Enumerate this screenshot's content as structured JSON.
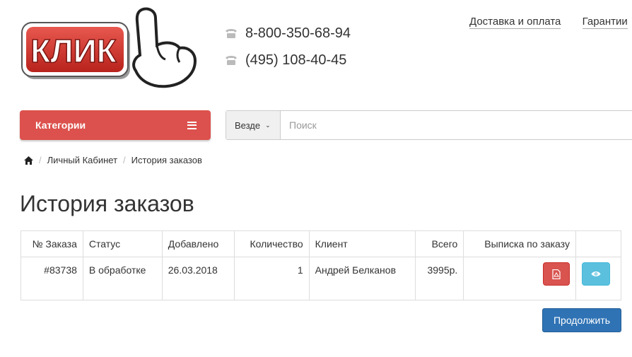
{
  "logo": {
    "text": "КЛИК"
  },
  "header": {
    "phones": [
      "8-800-350-68-94",
      "(495) 108-40-45"
    ],
    "links": [
      "Доставка и оплата",
      "Гарантии"
    ]
  },
  "categories_label": "Категории",
  "search": {
    "scope": "Везде",
    "placeholder": "Поиск"
  },
  "breadcrumb": [
    "Личный Кабинет",
    "История заказов"
  ],
  "page_title": "История заказов",
  "table": {
    "headers": [
      "№ Заказа",
      "Статус",
      "Добавлено",
      "Количество",
      "Клиент",
      "Всего",
      "Выписка по заказу",
      ""
    ],
    "rows": [
      {
        "id": "#83738",
        "status": "В обработке",
        "date": "26.03.2018",
        "qty": "1",
        "client": "Андрей Белканов",
        "total": "3995р."
      }
    ]
  },
  "continue_label": "Продолжить",
  "colors": {
    "brand_red": "#dc514d",
    "primary_blue": "#2f73b5",
    "info_cyan": "#5bc0de"
  },
  "icons": [
    "phone-icon",
    "hamburger-icon",
    "chevron-down-icon",
    "home-icon",
    "file-pdf-icon",
    "eye-icon"
  ]
}
